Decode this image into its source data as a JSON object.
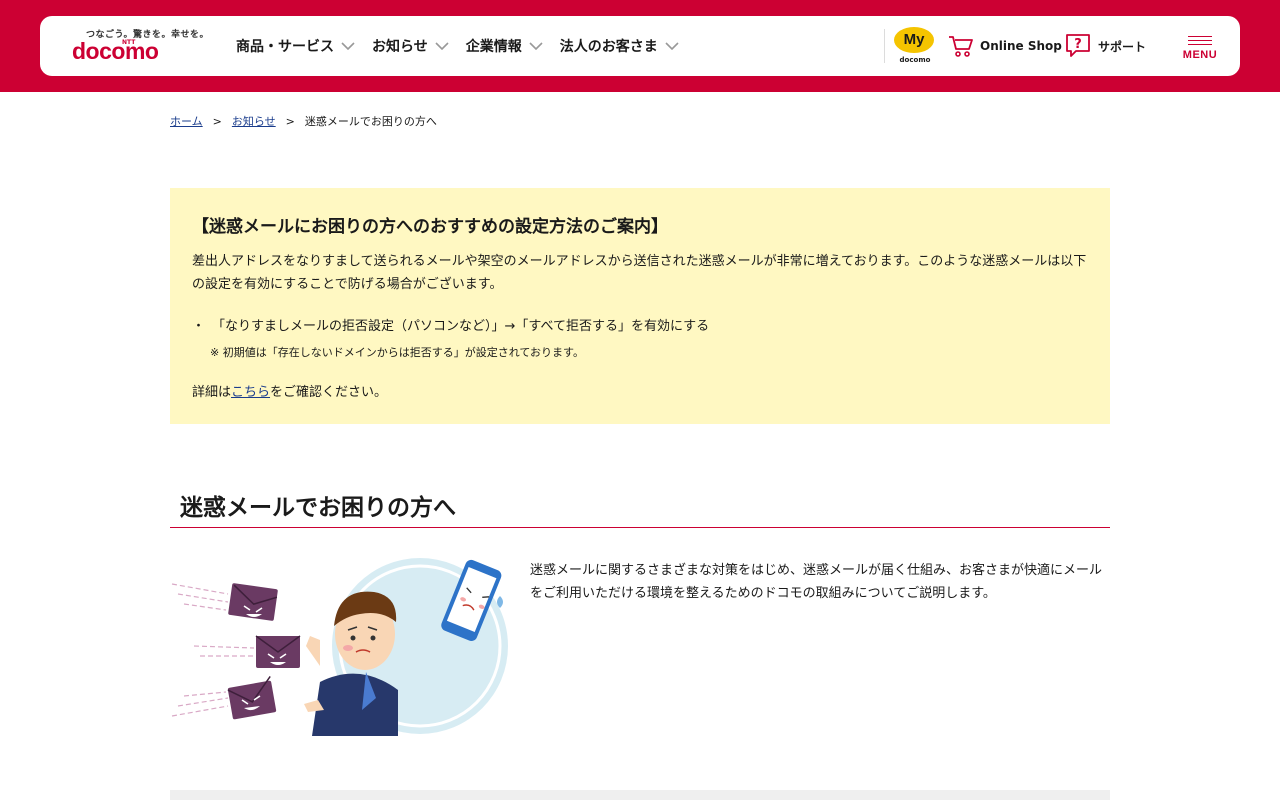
{
  "header": {
    "logo": {
      "tagline": "つなごう。驚きを。幸せを。",
      "ntt": "NTT",
      "wordmark": "docomo"
    },
    "nav": [
      {
        "label": "商品・サービス"
      },
      {
        "label": "お知らせ"
      },
      {
        "label": "企業情報"
      },
      {
        "label": "法人のお客さま"
      }
    ],
    "my_docomo": {
      "badge": "My",
      "sub": "docomo"
    },
    "online_shop": {
      "label": "Online Shop"
    },
    "support": {
      "label": "サポート"
    },
    "menu": {
      "label": "MENU"
    }
  },
  "breadcrumb": {
    "home": "ホーム",
    "notice": "お知らせ",
    "current": "迷惑メールでお困りの方へ",
    "separator": ">"
  },
  "notice": {
    "title": "【迷惑メールにお困りの方へのおすすめの設定方法のご案内】",
    "body": "差出人アドレスをなりすまして送られるメールや架空のメールアドレスから送信された迷惑メールが非常に増えております。このような迷惑メールは以下の設定を有効にすることで防げる場合がございます。",
    "bullet_mark": "・",
    "bullet": "「なりすましメールの拒否設定（パソコンなど）」→「すべて拒否する」を有効にする",
    "note": "※ 初期値は「存在しないドメインからは拒否する」が設定されております。",
    "detail_prefix": "詳細は",
    "detail_link": "こちら",
    "detail_suffix": "をご確認ください。"
  },
  "section": {
    "title": "迷惑メールでお困りの方へ",
    "intro": "迷惑メールに関するさまざまな対策をはじめ、迷惑メールが届く仕組み、お客さまが快適にメールをご利用いただける環境を整えるためのドコモの取組みについてご説明します。"
  },
  "colors": {
    "brand": "#cc0033",
    "notice_bg": "#fff8c2",
    "link": "#1a3c8c",
    "my_docomo": "#f5c400"
  },
  "icons": {
    "nav_chevron": "chevron-down-icon",
    "cart": "cart-icon",
    "support": "question-bubble-icon",
    "menu": "hamburger-icon"
  }
}
